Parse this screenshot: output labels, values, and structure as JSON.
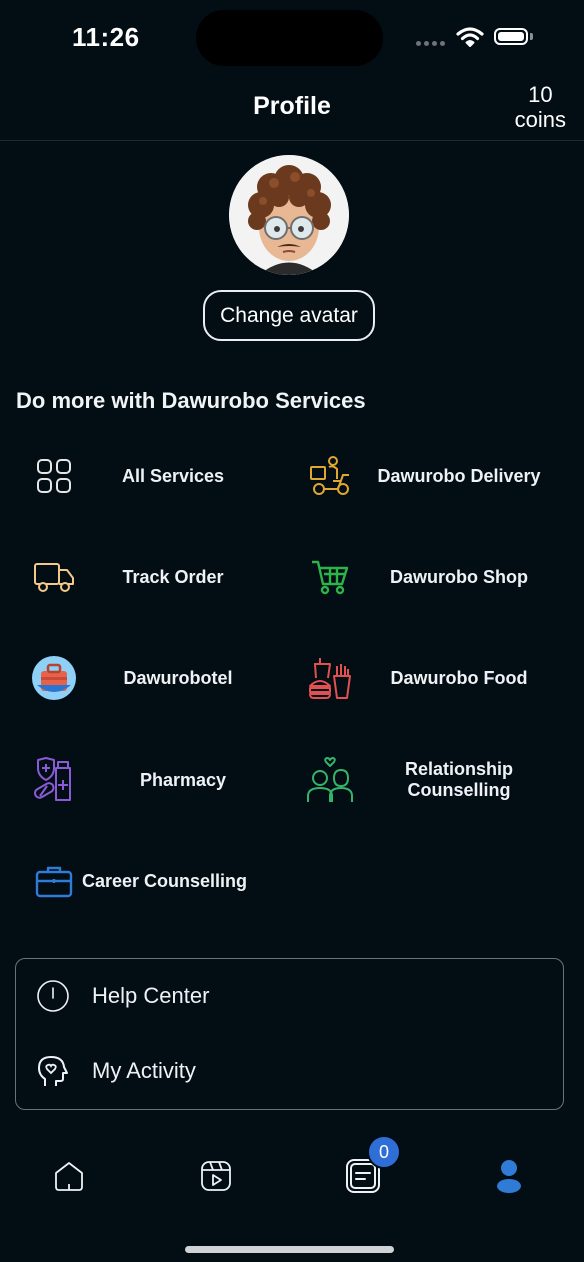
{
  "status_bar": {
    "time": "11:26"
  },
  "header": {
    "title": "Profile",
    "coins_count": "10",
    "coins_label": "coins"
  },
  "avatar": {
    "change_label": "Change avatar"
  },
  "services": {
    "section_title": "Do more with Dawurobo Services",
    "items": [
      {
        "label": "All Services",
        "icon": "grid-icon",
        "color": "#e6e6e6"
      },
      {
        "label": "Dawurobo Delivery",
        "icon": "scooter-icon",
        "color": "#e0a82e"
      },
      {
        "label": "Track Order",
        "icon": "truck-icon",
        "color": "#f1c988"
      },
      {
        "label": "Dawurobo Shop",
        "icon": "cart-icon",
        "color": "#2cb34a"
      },
      {
        "label": "Dawurobotel",
        "icon": "hotel-icon",
        "color": "#3aa6f0"
      },
      {
        "label": "Dawurobo Food",
        "icon": "fast-food-icon",
        "color": "#e35050"
      },
      {
        "label": "Pharmacy",
        "icon": "medicine-icon",
        "color": "#8a5bd6"
      },
      {
        "label": "Relationship Counselling",
        "icon": "couple-icon",
        "color": "#35b36a"
      },
      {
        "label": "Career Counselling",
        "icon": "briefcase-icon",
        "color": "#2f7bd6"
      }
    ]
  },
  "menu": {
    "help_center": "Help Center",
    "my_activity": "My Activity"
  },
  "tabbar": {
    "notification_count": "0",
    "active_tab": "profile",
    "accent": "#2f7bd6"
  }
}
